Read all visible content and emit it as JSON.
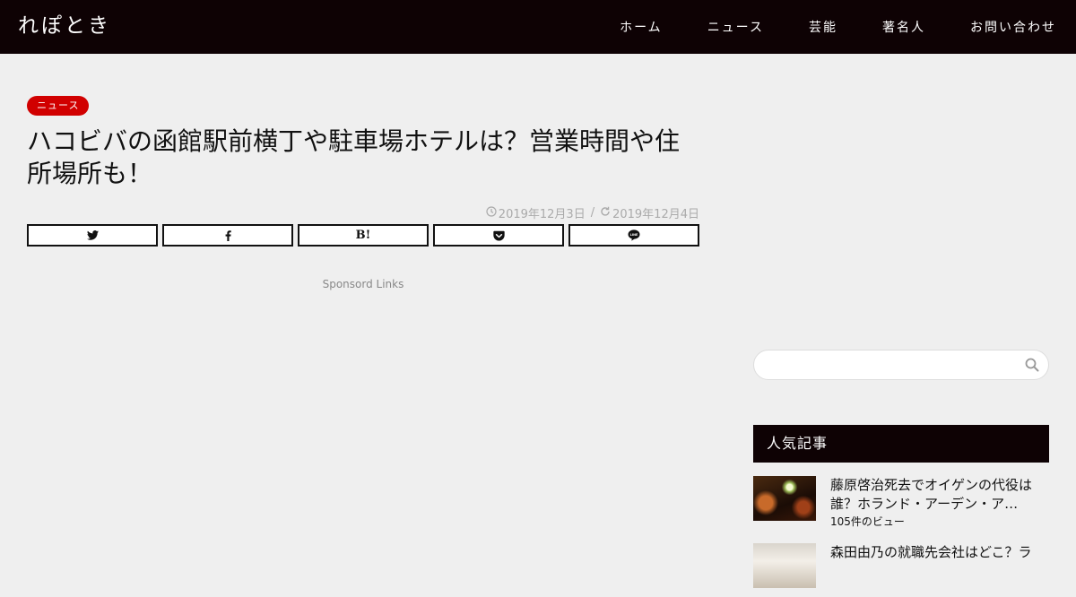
{
  "header": {
    "site_title": "れぽとき",
    "nav": [
      "ホーム",
      "ニュース",
      "芸能",
      "著名人",
      "お問い合わせ"
    ]
  },
  "article": {
    "category": "ニュース",
    "title": "ハコビバの函館駅前横丁や駐車場ホテルは？営業時間や住所場所も！",
    "published": "2019年12月3日",
    "separator": "/",
    "updated": "2019年12月4日",
    "share_buttons": [
      {
        "name": "twitter",
        "glyph": "🐦︎"
      },
      {
        "name": "facebook",
        "glyph": "f"
      },
      {
        "name": "hatena",
        "glyph": "B!"
      },
      {
        "name": "pocket",
        "glyph": "pocket"
      },
      {
        "name": "line",
        "glyph": "LINE"
      }
    ],
    "sponsored": "Sponsord Links"
  },
  "sidebar": {
    "search": {
      "value": "",
      "placeholder": ""
    },
    "popular_title": "人気記事",
    "popular": [
      {
        "title": "藤原啓治死去でオイゲンの代役は誰？ホランド・アーデン・ア…",
        "views": "105件のビュー"
      },
      {
        "title": "森田由乃の就職先会社はどこ？ラ",
        "views": ""
      }
    ]
  },
  "colors": {
    "header_bg": "#0e0204",
    "badge": "#d10000",
    "page_bg": "#efefef"
  }
}
